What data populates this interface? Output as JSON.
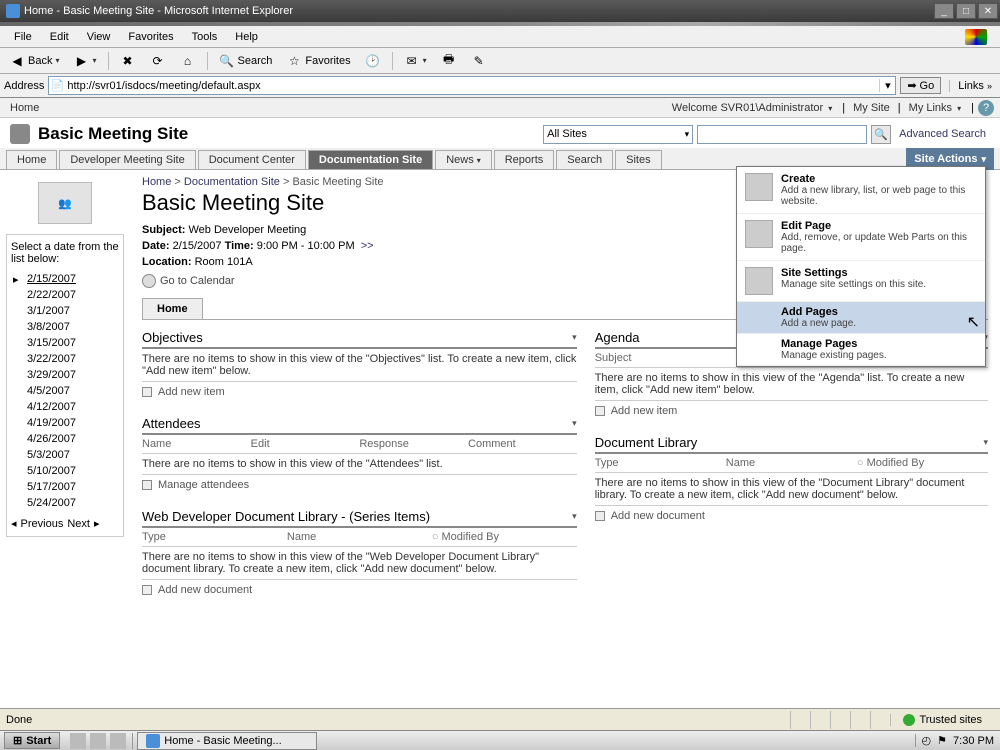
{
  "window": {
    "title": "Home - Basic Meeting Site - Microsoft Internet Explorer"
  },
  "menus": {
    "file": "File",
    "edit": "Edit",
    "view": "View",
    "favorites": "Favorites",
    "tools": "Tools",
    "help": "Help"
  },
  "toolbar": {
    "back": "Back",
    "search": "Search",
    "favorites": "Favorites"
  },
  "address": {
    "label": "Address",
    "url": "http://svr01/isdocs/meeting/default.aspx",
    "go": "Go",
    "links": "Links"
  },
  "sp": {
    "topHome": "Home",
    "welcome": "Welcome SVR01\\Administrator",
    "mySite": "My Site",
    "myLinks": "My Links",
    "siteTitle": "Basic Meeting Site",
    "scope": "All Sites",
    "advSearch": "Advanced Search",
    "tabs": [
      "Home",
      "Developer Meeting Site",
      "Document Center",
      "Documentation Site",
      "News",
      "Reports",
      "Search",
      "Sites"
    ],
    "activeTab": "Documentation Site",
    "siteActions": "Site Actions"
  },
  "breadcrumb": {
    "a": "Home",
    "b": "Documentation Site",
    "c": "Basic Meeting Site"
  },
  "page": {
    "title": "Basic Meeting Site",
    "subjectLbl": "Subject:",
    "subject": "Web Developer Meeting",
    "dateLbl": "Date:",
    "date": "2/15/2007",
    "timeLbl": "Time:",
    "time": "9:00 PM - 10:00 PM",
    "more": ">>",
    "locationLbl": "Location:",
    "location": "Room 101A",
    "goto": "Go to Calendar",
    "homeTab": "Home"
  },
  "datePanel": {
    "hdr": "Select a date from the list below:",
    "dates": [
      "2/15/2007",
      "2/22/2007",
      "3/1/2007",
      "3/8/2007",
      "3/15/2007",
      "3/22/2007",
      "3/29/2007",
      "4/5/2007",
      "4/12/2007",
      "4/19/2007",
      "4/26/2007",
      "5/3/2007",
      "5/10/2007",
      "5/17/2007",
      "5/24/2007"
    ],
    "prev": "Previous",
    "next": "Next"
  },
  "wp": {
    "objectives": {
      "title": "Objectives",
      "empty": "There are no items to show in this view of the \"Objectives\" list. To create a new item, click \"Add new item\" below.",
      "add": "Add new item"
    },
    "attendees": {
      "title": "Attendees",
      "cols": [
        "Name",
        "Edit",
        "Response",
        "Comment"
      ],
      "empty": "There are no items to show in this view of the \"Attendees\" list.",
      "add": "Manage attendees"
    },
    "devlib": {
      "title": "Web Developer Document Library - (Series Items)",
      "cols": [
        "Type",
        "Name",
        "Modified By"
      ],
      "empty": "There are no items to show in this view of the \"Web Developer Document Library\" document library. To create a new item, click \"Add new document\" below.",
      "add": "Add new document"
    },
    "agenda": {
      "title": "Agenda",
      "sub": "Subject",
      "empty": "There are no items to show in this view of the \"Agenda\" list. To create a new item, click \"Add new item\" below.",
      "add": "Add new item"
    },
    "doclib": {
      "title": "Document Library",
      "cols": [
        "Type",
        "Name",
        "Modified By"
      ],
      "empty": "There are no items to show in this view of the \"Document Library\" document library. To create a new item, click \"Add new document\" below.",
      "add": "Add new document"
    }
  },
  "actionsMenu": [
    {
      "t": "Create",
      "d": "Add a new library, list, or web page to this website."
    },
    {
      "t": "Edit Page",
      "d": "Add, remove, or update Web Parts on this page."
    },
    {
      "t": "Site Settings",
      "d": "Manage site settings on this site."
    },
    {
      "t": "Add Pages",
      "d": "Add a new page.",
      "hover": true,
      "small": true
    },
    {
      "t": "Manage Pages",
      "d": "Manage existing pages.",
      "small": true
    }
  ],
  "status": {
    "done": "Done",
    "trusted": "Trusted sites"
  },
  "taskbar": {
    "start": "Start",
    "task": "Home - Basic Meeting...",
    "time": "7:30 PM"
  }
}
